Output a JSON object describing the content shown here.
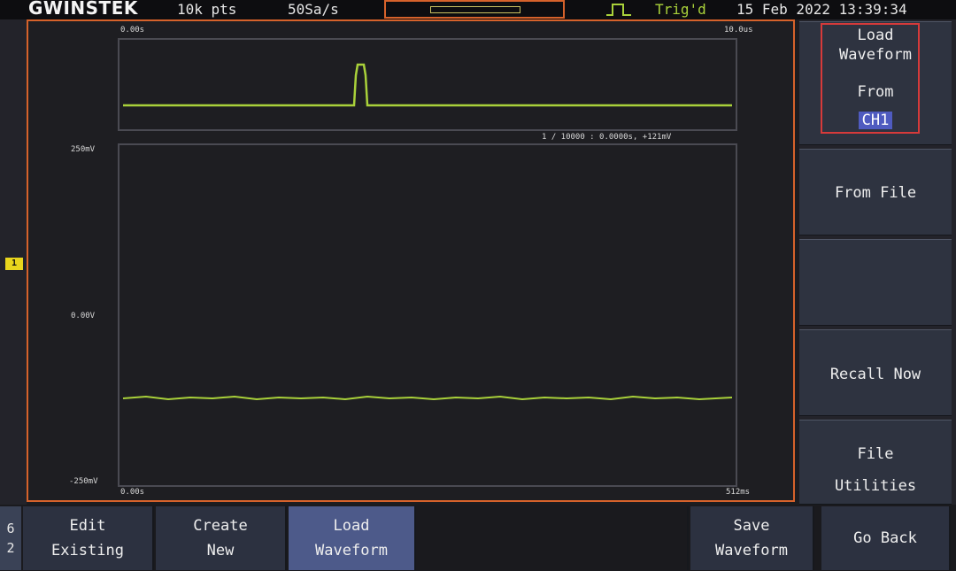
{
  "top": {
    "brand": "GWINSTEK",
    "points": "10k pts",
    "sample_rate": "50Sa/s",
    "trig_status": "Trig'd",
    "datetime": "15 Feb 2022 13:39:34"
  },
  "channel_marker": "1",
  "overview": {
    "start_label": "0.00s",
    "end_label": "10.0us",
    "info": "1 / 10000 : 0.0000s, +121mV"
  },
  "main": {
    "y_top": "250mV",
    "y_mid": "0.00V",
    "y_bottom": "-250mV",
    "x_start": "0.00s",
    "x_end": "512ms"
  },
  "menu": {
    "load_title_line1": "Load",
    "load_title_line2": "Waveform",
    "from_label": "From",
    "from_value": "CH1",
    "from_file": "From File",
    "recall_now": "Recall Now",
    "file_utilities_line1": "File",
    "file_utilities_line2": "Utilities"
  },
  "bottom": {
    "page_top": "6",
    "page_bottom": "2",
    "edit_line1": "Edit",
    "edit_line2": "Existing",
    "create_line1": "Create",
    "create_line2": "New",
    "load_line1": "Load",
    "load_line2": "Waveform",
    "save_line1": "Save",
    "save_line2": "Waveform",
    "go_back": "Go Back"
  },
  "colors": {
    "trace": "#a9d13a",
    "frame": "#d6622b",
    "highlight": "#d63a3a",
    "channel1": "#e8d51d"
  }
}
